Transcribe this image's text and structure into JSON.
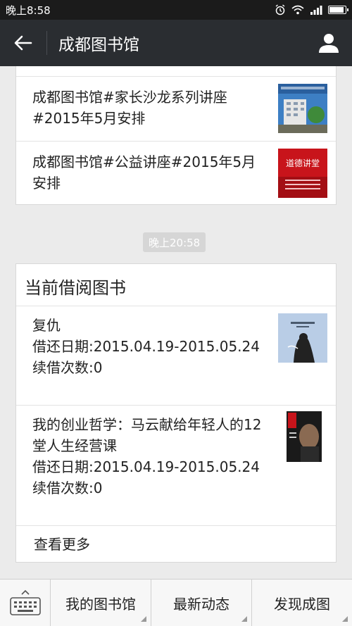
{
  "status": {
    "time": "晚上8:58",
    "battery_level": 0.85
  },
  "nav": {
    "title": "成都图书馆"
  },
  "articles": [
    {
      "title": "成都图书馆#家长沙龙系列讲座#2015年5月安排",
      "thumb": "library-building-photo"
    },
    {
      "title": "成都图书馆#公益讲座#2015年5月安排",
      "thumb": "lecture-poster",
      "thumb_text": "道德讲堂"
    }
  ],
  "timestamp": "晚上20:58",
  "borrow": {
    "title": "当前借阅图书",
    "books": [
      {
        "name": "复仇",
        "period": "借还日期:2015.04.19-2015.05.24",
        "renew": "续借次数:0"
      },
      {
        "name": "我的创业哲学：马云献给年轻人的12堂人生经营课",
        "period": "借还日期:2015.04.19-2015.05.24",
        "renew": "续借次数:0"
      }
    ],
    "more": "查看更多"
  },
  "menu": {
    "items": [
      "我的图书馆",
      "最新动态",
      "发现成图"
    ]
  },
  "colors": {
    "navbar": "#2a2d31",
    "statusbar": "#1b1b1b",
    "background": "#ebebeb",
    "accent_red": "#c8141b"
  }
}
